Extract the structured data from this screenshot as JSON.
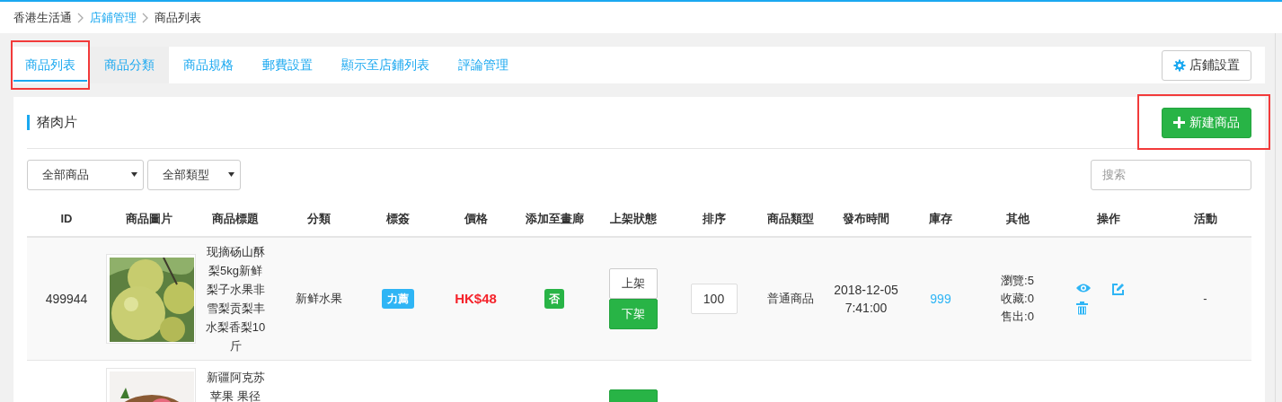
{
  "breadcrumb": [
    {
      "label": "香港生活通",
      "link": false
    },
    {
      "label": "店鋪管理",
      "link": true
    },
    {
      "label": "商品列表",
      "link": false
    }
  ],
  "tabs": [
    {
      "label": "商品列表",
      "selected": true,
      "highlighted": true,
      "hovered": false
    },
    {
      "label": "商品分類",
      "selected": false,
      "highlighted": false,
      "hovered": true
    },
    {
      "label": "商品規格",
      "selected": false,
      "highlighted": false,
      "hovered": false
    },
    {
      "label": "郵費設置",
      "selected": false,
      "highlighted": false,
      "hovered": false
    },
    {
      "label": "顯示至店鋪列表",
      "selected": false,
      "highlighted": false,
      "hovered": false
    },
    {
      "label": "評論管理",
      "selected": false,
      "highlighted": false,
      "hovered": false
    }
  ],
  "store_settings_button": "店鋪設置",
  "panel_title": "猪肉片",
  "new_product_button": {
    "label": "新建商品",
    "highlighted": true
  },
  "filters": [
    "全部商品",
    "全部類型"
  ],
  "search": {
    "placeholder": "搜索"
  },
  "table": {
    "columns": [
      "ID",
      "商品圖片",
      "商品標題",
      "分類",
      "標簽",
      "價格",
      "添加至畫廊",
      "上架狀態",
      "排序",
      "商品類型",
      "發布時間",
      "庫存",
      "其他",
      "操作",
      "活動"
    ],
    "rows": [
      {
        "id": "499944",
        "picture": {
          "kind": "picture"
        },
        "title": "现摘砀山酥梨5kg新鲜梨子水果非雪梨贡梨丰水梨香梨10斤",
        "category": "新鲜水果",
        "tag": "力薦",
        "price": "HK$48",
        "gallery": "否",
        "status_buttons": [
          {
            "label": "上架",
            "selected": false
          },
          {
            "label": "下架",
            "selected": true
          }
        ],
        "sort": "100",
        "type": "普通商品",
        "published": [
          "2018-12-05",
          "7:41:00"
        ],
        "stock": "999",
        "other": [
          "瀏覽:5",
          "收藏:0",
          "售出:0"
        ],
        "activity": "-"
      },
      {
        "picture": {
          "kind": "picture"
        },
        "title": "新疆阿克苏苹果 果径",
        "status_buttons": [
          {
            "selected": true
          }
        ]
      }
    ]
  }
}
